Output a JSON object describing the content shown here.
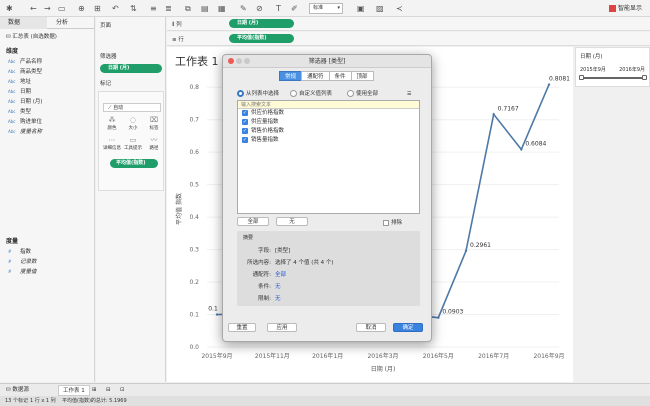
{
  "toolbar": {
    "show_me_label": "智能显示",
    "standard_label": "标准"
  },
  "left": {
    "tab_data": "数据",
    "tab_analysis": "分析",
    "source": "汇总表 (自选数据)",
    "dims_label": "维度",
    "dims": [
      {
        "type": "Abc",
        "name": "产品名称"
      },
      {
        "type": "Abc",
        "name": "商品类型"
      },
      {
        "type": "Abc",
        "name": "地址"
      },
      {
        "type": "Abc",
        "name": "日期"
      },
      {
        "type": "Abc",
        "name": "日期 (月)"
      },
      {
        "type": "Abc",
        "name": "类型"
      },
      {
        "type": "Abc",
        "name": "购进单位"
      },
      {
        "type": "Abc",
        "name": "度量名称"
      }
    ],
    "measures_label": "度量",
    "measures": [
      {
        "type": "#",
        "name": "指数"
      },
      {
        "type": "#",
        "name": "记录数"
      },
      {
        "type": "#",
        "name": "度量值"
      }
    ]
  },
  "mid": {
    "pages": "页面",
    "filters": "筛选器",
    "filter_pill": "日期 (月)",
    "marks": "标记",
    "marks_type": "自动",
    "mbtns": [
      "颜色",
      "大小",
      "标签",
      "详细信息",
      "工具提示",
      "路径"
    ],
    "mark_pill": "平均值(指数)"
  },
  "shelves": {
    "cols_label": "列",
    "cols_pill": "日期 (月)",
    "rows_label": "行",
    "rows_pill": "平均值(指数)"
  },
  "canvas": {
    "title": "工作表 1"
  },
  "chart_data": {
    "type": "line",
    "x": [
      "2015年9月",
      "2015年10月",
      "2015年11月",
      "2015年12月",
      "2016年1月",
      "2016年2月",
      "2016年3月",
      "2016年4月",
      "2016年5月",
      "2016年6月",
      "2016年7月",
      "2016年8月",
      "2016年9月"
    ],
    "x_ticks": [
      "2015年9月",
      "2015年11月",
      "2016年1月",
      "2016年3月",
      "2016年5月",
      "2016年7月",
      "2016年9月"
    ],
    "values": [
      0.1,
      0.1,
      0.1,
      0.1,
      0.1,
      0.1,
      0.1,
      0.1,
      0.0903,
      0.2961,
      0.7167,
      0.6084,
      0.8081
    ],
    "labels": [
      "0.1",
      "",
      "",
      "",
      "",
      "",
      "",
      "",
      "0.0903",
      "0.2961",
      "0.7167",
      "0.6084",
      "0.8081"
    ],
    "yticks": [
      "0.8",
      "0.7",
      "0.6",
      "0.5",
      "0.4",
      "0.3",
      "0.2",
      "0.1",
      "0.0"
    ],
    "ylabel": "平均值 指数",
    "xlabel": "日期 (月)",
    "ylim": [
      0,
      0.85
    ],
    "color": "#4e79a7"
  },
  "right": {
    "filter_title": "日期 (月)",
    "range_from": "2015年9月",
    "range_to": "2016年9月"
  },
  "dialog": {
    "title": "筛选器 [类型]",
    "tabs": [
      "常规",
      "通配符",
      "条件",
      "顶部"
    ],
    "radios": [
      "从列表中选择",
      "自定义值列表",
      "使用全部"
    ],
    "search_placeholder": "输入搜索文本",
    "items": [
      "供应价格指数",
      "供应量指数",
      "销售价格指数",
      "销售量指数"
    ],
    "all_label": "全部",
    "none_label": "无",
    "exclude_label": "排除",
    "summary_label": "摘要",
    "summary": [
      {
        "k": "字段:",
        "v": "[类型]"
      },
      {
        "k": "所选内容:",
        "v": "选择了 4 个值 (共 4 个)"
      },
      {
        "k": "通配符:",
        "v": "全部"
      },
      {
        "k": "条件:",
        "v": "无"
      },
      {
        "k": "限制:",
        "v": "无"
      }
    ],
    "reset": "重置",
    "apply": "应用",
    "cancel": "取消",
    "ok": "确定"
  },
  "bottom": {
    "datasource": "数据源",
    "sheet": "工作表 1"
  },
  "status": {
    "marks": "13 个标记",
    "rows": "1 行 x 1 列",
    "sum": "平均值(指数)的总计: 5.1969"
  }
}
